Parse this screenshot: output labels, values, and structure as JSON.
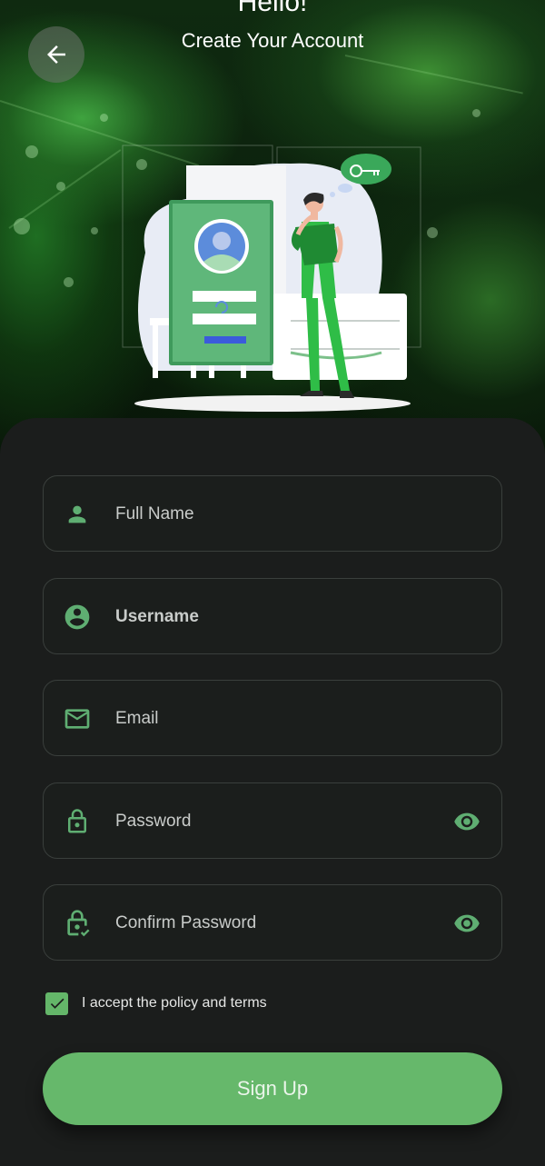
{
  "header": {
    "greeting": "Hello!",
    "subtitle": "Create Your Account"
  },
  "icons": {
    "back": "arrow-left-icon",
    "full_name": "person-icon",
    "username": "account-circle-icon",
    "email": "mail-icon",
    "password": "lock-icon",
    "confirm_password": "lock-check-icon",
    "visibility": "eye-icon",
    "checkbox": "check-icon"
  },
  "form": {
    "fields": [
      {
        "label": "Full Name"
      },
      {
        "label": "Username"
      },
      {
        "label": "Email"
      },
      {
        "label": "Password"
      },
      {
        "label": "Confirm Password"
      }
    ],
    "terms_label": "I accept the policy and terms",
    "terms_checked": true,
    "submit_label": "Sign Up"
  },
  "colors": {
    "accent": "#66b86b",
    "icon": "#5fae72",
    "sheet_bg": "#1b1d1c",
    "field_border": "#3a3f3c"
  }
}
